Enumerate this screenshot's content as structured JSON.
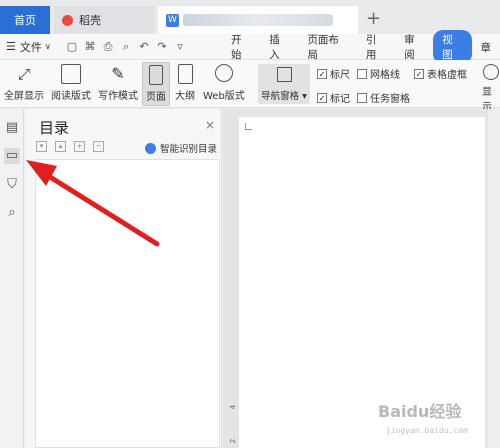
{
  "tabs": {
    "home": "首页",
    "docer": "稻壳",
    "active_prefix": "W"
  },
  "menu": {
    "file": "文件",
    "tabs": [
      "开始",
      "插入",
      "页面布局",
      "引用",
      "审阅",
      "视图",
      "章"
    ]
  },
  "ribbon": {
    "fullscreen": "全屏显示",
    "reading": "阅读版式",
    "writing": "写作模式",
    "page": "页面",
    "outline": "大纲",
    "web": "Web版式",
    "nav_pane": "导航窗格",
    "ruler": "标尺",
    "gridlines": "网格线",
    "table_gridlines": "表格虚框",
    "marks": "标记",
    "task_pane": "任务窗格",
    "display": "显示"
  },
  "navpane": {
    "title": "目录",
    "close": "×",
    "smart_toc": "智能识别目录"
  },
  "doc": {
    "ruler_4": "4",
    "ruler_2": "2"
  },
  "watermark": {
    "text": "Baidu经验",
    "url": "jingyan.baidu.com"
  }
}
